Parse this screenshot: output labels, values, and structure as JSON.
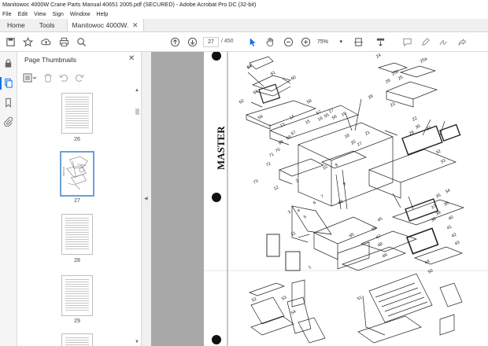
{
  "window": {
    "title": "Manitowoc 4000W Crane Parts Manual 40651 2005.pdf (SECURED) - Adobe Acrobat Pro DC (32-bit)"
  },
  "menu": [
    "File",
    "Edit",
    "View",
    "Sign",
    "Window",
    "Help"
  ],
  "tabs": {
    "home": "Home",
    "tools": "Tools",
    "document": "Manitowoc 4000W..."
  },
  "toolbar": {
    "page_current": "27",
    "page_total": "/ 450",
    "zoom": "75%"
  },
  "panel": {
    "title": "Page Thumbnails",
    "thumbnails": [
      {
        "label": "26",
        "selected": false
      },
      {
        "label": "27",
        "selected": true
      },
      {
        "label": "28",
        "selected": false
      },
      {
        "label": "29",
        "selected": false
      }
    ]
  },
  "page": {
    "stamp": "MASTER",
    "callouts": [
      "64",
      "61",
      "60",
      "63",
      "62",
      "59",
      "58",
      "57",
      "55",
      "56",
      "50",
      "49",
      "48",
      "47",
      "46",
      "45",
      "44",
      "43",
      "42",
      "41",
      "40",
      "39",
      "38",
      "37",
      "36",
      "35",
      "34",
      "33",
      "32",
      "31",
      "30",
      "29",
      "28",
      "27",
      "26",
      "25",
      "25a",
      "25b",
      "24",
      "23",
      "22",
      "21",
      "20",
      "19",
      "18",
      "17",
      "16",
      "15",
      "14",
      "13",
      "12",
      "11",
      "10",
      "9",
      "8",
      "7",
      "6",
      "5",
      "4",
      "3",
      "2",
      "1",
      "52",
      "53",
      "54",
      "51",
      "65",
      "66",
      "67",
      "68",
      "69",
      "70",
      "71",
      "72",
      "73",
      "74"
    ]
  },
  "colors": {
    "accent": "#1473e6",
    "viewer_bg": "#a8a8a8"
  }
}
